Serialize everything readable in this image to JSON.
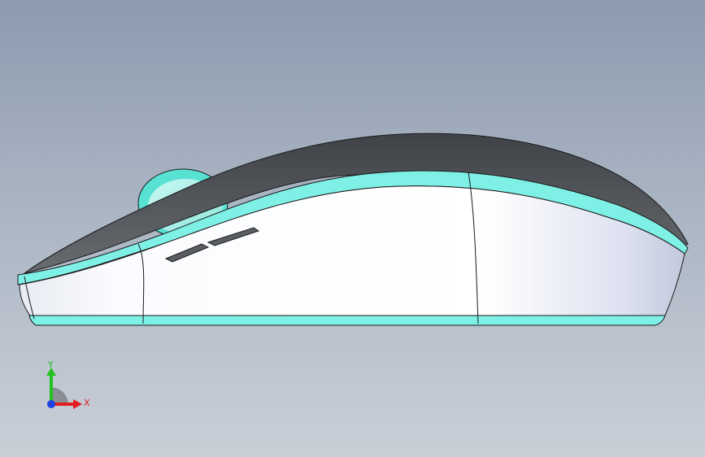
{
  "viewport": {
    "colors": {
      "background_top": "#8d9bb0",
      "background_bottom": "#c9cfd7",
      "shell_top": "#505458",
      "shell_body": "#f4f6fb",
      "accent_band": "#7ff0e6",
      "edge_line": "#1a1a1a"
    }
  },
  "triad": {
    "y_label": "Y",
    "x_label": "X",
    "colors": {
      "y_axis": "#22c020",
      "x_axis": "#e02020",
      "z_axis": "#2040e0"
    }
  }
}
